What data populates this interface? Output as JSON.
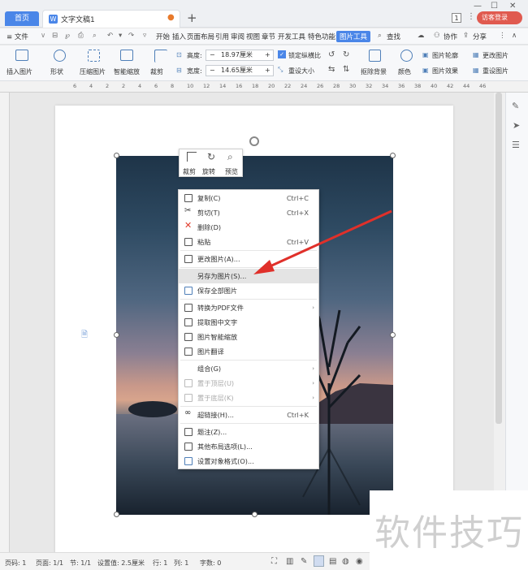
{
  "titlebar": {
    "home_tab": "首页",
    "doc_tab": "文字文稿1",
    "window_badge": "1",
    "login_button": "访客登录"
  },
  "menubar": {
    "file": "≡ 文件",
    "items": [
      "开始",
      "插入",
      "页面布局",
      "引用",
      "审阅",
      "视图",
      "章节",
      "开发工具",
      "特色功能",
      "图片工具"
    ],
    "active": "图片工具",
    "search": "查找",
    "collab": "协作",
    "share": "分享"
  },
  "ribbon": {
    "insert_image": "插入图片",
    "shape": "形状",
    "compress": "压缩图片",
    "smart_zoom": "智能缩放",
    "crop": "裁剪",
    "height_label": "高度:",
    "height_value": "18.97厘米",
    "width_label": "宽度:",
    "width_value": "14.65厘米",
    "lock_ratio": "锁定纵横比",
    "reset_size": "重设大小",
    "remove_bg": "抠除背景",
    "color": "颜色",
    "outline": "图片轮廓",
    "change_image": "更改图片",
    "effect": "图片效果",
    "reset_image": "重设图片"
  },
  "ruler": {
    "ticks": [
      "6",
      "4",
      "2",
      "2",
      "4",
      "6",
      "8",
      "10",
      "12",
      "14",
      "16",
      "18",
      "20",
      "22",
      "24",
      "26",
      "28",
      "30",
      "32",
      "34",
      "36",
      "38",
      "40",
      "42",
      "44",
      "46"
    ]
  },
  "image_toolbar": {
    "crop": "裁剪",
    "rotate": "旋转",
    "preview": "预览"
  },
  "context_menu": {
    "items": [
      {
        "label": "复制(C)",
        "shortcut": "Ctrl+C",
        "icon": "copy-icon"
      },
      {
        "label": "剪切(T)",
        "shortcut": "Ctrl+X",
        "icon": "scissors-icon"
      },
      {
        "label": "删除(D)",
        "shortcut": "",
        "icon": "delete-icon"
      },
      {
        "label": "粘贴",
        "shortcut": "Ctrl+V",
        "icon": "paste-icon"
      },
      {
        "label": "更改图片(A)...",
        "shortcut": "",
        "icon": "change-image-icon"
      },
      {
        "label": "另存为图片(S)...",
        "shortcut": "",
        "icon": ""
      },
      {
        "label": "保存全部图片",
        "shortcut": "",
        "icon": "save-all-icon"
      },
      {
        "label": "转换为PDF文件",
        "shortcut": "",
        "icon": "pdf-icon"
      },
      {
        "label": "提取图中文字",
        "shortcut": "",
        "icon": "extract-text-icon"
      },
      {
        "label": "图片智能缩放",
        "shortcut": "",
        "icon": "smart-zoom-icon"
      },
      {
        "label": "图片翻译",
        "shortcut": "",
        "icon": "translate-icon"
      },
      {
        "label": "组合(G)",
        "shortcut": "",
        "icon": ""
      },
      {
        "label": "置于顶层(U)",
        "shortcut": "",
        "icon": "bring-front-icon"
      },
      {
        "label": "置于底层(K)",
        "shortcut": "",
        "icon": "send-back-icon"
      },
      {
        "label": "超链接(H)...",
        "shortcut": "Ctrl+K",
        "icon": "link-icon"
      },
      {
        "label": "题注(Z)...",
        "shortcut": "",
        "icon": "caption-icon"
      },
      {
        "label": "其他布局选项(L)...",
        "shortcut": "",
        "icon": "layout-icon"
      },
      {
        "label": "设置对象格式(O)...",
        "shortcut": "",
        "icon": "format-icon"
      }
    ]
  },
  "statusbar": {
    "page_code": "页码: 1",
    "pages": "页面: 1/1",
    "section": "节: 1/1",
    "setting": "设置值: 2.5厘米",
    "row": "行: 1",
    "col": "列: 1",
    "chars": "字数: 0"
  },
  "watermark": "软件技巧",
  "colors": {
    "accent": "#4a86e8",
    "arrow": "#e0302a",
    "login": "#e05a4f"
  }
}
